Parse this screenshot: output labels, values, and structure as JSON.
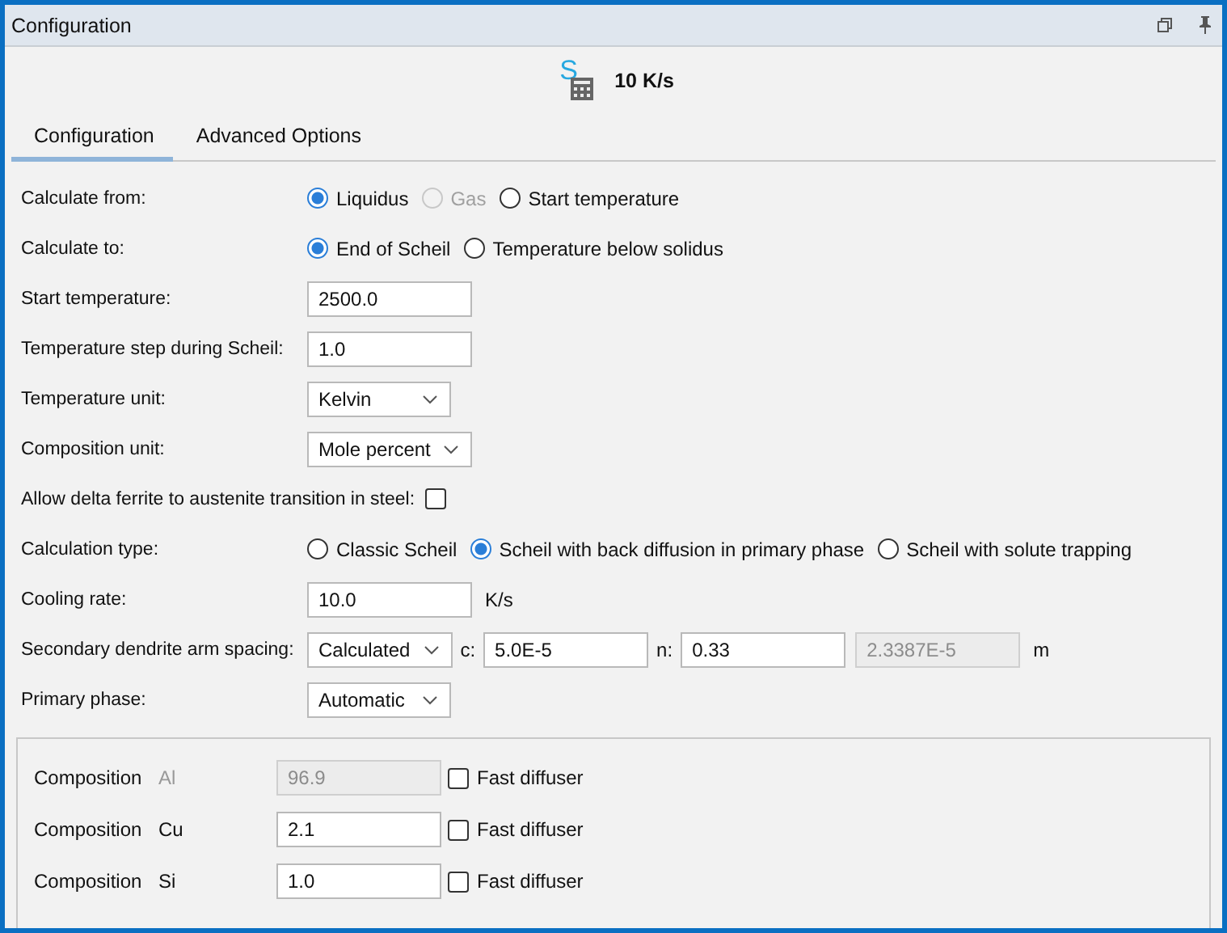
{
  "window": {
    "title": "Configuration"
  },
  "header": {
    "icon_letter": "S",
    "title": "10 K/s"
  },
  "tabs": [
    {
      "label": "Configuration",
      "selected": true
    },
    {
      "label": "Advanced Options",
      "selected": false
    }
  ],
  "rows": [
    {
      "kind": "radio",
      "label": "Calculate from:",
      "options": [
        {
          "label": "Liquidus",
          "selected": true,
          "disabled": false
        },
        {
          "label": "Gas",
          "selected": false,
          "disabled": true
        },
        {
          "label": "Start temperature",
          "selected": false,
          "disabled": false
        }
      ]
    },
    {
      "kind": "radio",
      "label": "Calculate to:",
      "options": [
        {
          "label": "End of Scheil",
          "selected": true,
          "disabled": false
        },
        {
          "label": "Temperature below solidus",
          "selected": false,
          "disabled": false
        }
      ]
    },
    {
      "kind": "text",
      "label": "Start temperature:",
      "value": "2500.0"
    },
    {
      "kind": "text",
      "label": "Temperature step during Scheil:",
      "value": "1.0"
    },
    {
      "kind": "select",
      "label": "Temperature unit:",
      "value": "Kelvin"
    },
    {
      "kind": "select",
      "label": "Composition unit:",
      "value": "Mole percent"
    },
    {
      "kind": "checkbox",
      "label": "Allow delta ferrite to austenite transition in steel:",
      "checked": false
    },
    {
      "kind": "radio",
      "label": "Calculation type:",
      "options": [
        {
          "label": "Classic Scheil",
          "selected": false,
          "disabled": false
        },
        {
          "label": "Scheil with back diffusion in primary phase",
          "selected": true,
          "disabled": false
        },
        {
          "label": "Scheil with solute trapping",
          "selected": false,
          "disabled": false
        }
      ]
    },
    {
      "kind": "text",
      "label": "Cooling rate:",
      "value": "10.0",
      "unit": "K/s"
    },
    {
      "kind": "dendrite",
      "label": "Secondary dendrite arm spacing:",
      "value": "Calculated",
      "c_label": "c:",
      "c_value": "5.0E-5",
      "n_label": "n:",
      "n_value": "0.33",
      "result": "2.3387E-5",
      "unit": "m"
    },
    {
      "kind": "select",
      "label": "Primary phase:",
      "value": "Automatic"
    }
  ],
  "composition": [
    {
      "label": "Composition",
      "element": "Al",
      "value": "96.9",
      "disabled": true,
      "fast_label": "Fast diffuser",
      "fast_diffuser": false
    },
    {
      "label": "Composition",
      "element": "Cu",
      "value": "2.1",
      "disabled": false,
      "fast_label": "Fast diffuser",
      "fast_diffuser": false
    },
    {
      "label": "Composition",
      "element": "Si",
      "value": "1.0",
      "disabled": false,
      "fast_label": "Fast diffuser",
      "fast_diffuser": false
    }
  ]
}
